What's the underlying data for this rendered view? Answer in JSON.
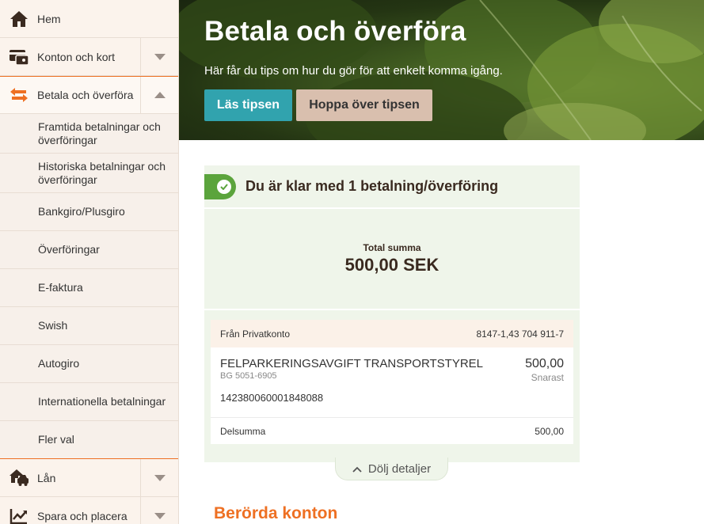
{
  "colors": {
    "accent": "#ee7023",
    "primary_button": "#31a3ae",
    "secondary_button": "#d9bfae",
    "success": "#5ba43c",
    "card_bg": "#eff5ea",
    "sidebar_bg": "#f7f0ea"
  },
  "sidebar": {
    "main_items": [
      {
        "label": "Hem",
        "icon": "home-icon"
      },
      {
        "label": "Konton och kort",
        "icon": "wallet-card-icon"
      },
      {
        "label": "Betala och överföra",
        "icon": "transfer-arrows-icon",
        "expanded": true
      },
      {
        "label": "Lån",
        "icon": "house-car-icon"
      },
      {
        "label": "Spara och placera",
        "icon": "chart-line-icon"
      }
    ],
    "sub_items": [
      {
        "label": "Framtida betalningar och överföringar"
      },
      {
        "label": "Historiska betalningar och överföringar"
      },
      {
        "label": "Bankgiro/Plusgiro"
      },
      {
        "label": "Överföringar"
      },
      {
        "label": "E-faktura"
      },
      {
        "label": "Swish"
      },
      {
        "label": "Autogiro"
      },
      {
        "label": "Internationella betalningar"
      },
      {
        "label": "Fler val"
      }
    ]
  },
  "hero": {
    "title": "Betala och överföra",
    "subtitle": "Här får du tips om hur du gör för att enkelt komma igång.",
    "primary_button": "Läs tipsen",
    "secondary_button": "Hoppa över tipsen"
  },
  "summary": {
    "status": "Du är klar med 1 betalning/överföring",
    "total_label": "Total summa",
    "total_value": "500,00 SEK",
    "from_label": "Från Privatkonto",
    "from_account": "8147-1,43 704 911-7",
    "payment": {
      "recipient": "FELPARKERINGSAVGIFT TRANSPORTSTYREL",
      "bankgiro": "BG 5051-6905",
      "amount": "500,00",
      "when": "Snarast",
      "reference": "142380060001848088"
    },
    "subtotal_label": "Delsumma",
    "subtotal_value": "500,00",
    "toggle_label": "Dölj detaljer"
  },
  "section": {
    "title": "Berörda konton"
  }
}
